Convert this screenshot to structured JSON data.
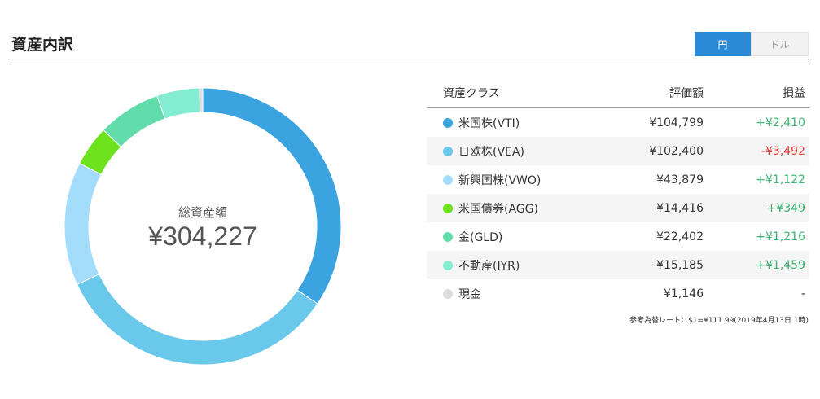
{
  "header": {
    "title": "資産内訳",
    "toggle": [
      "円",
      "ドル"
    ]
  },
  "total": {
    "label": "総資産額",
    "value": "¥304,227"
  },
  "table": {
    "columns": [
      "資産クラス",
      "評価額",
      "損益"
    ],
    "rows": [
      {
        "name": "米国株(VTI)",
        "value": "¥104,799",
        "pnl": "+¥2,410",
        "color": "#3ba3df",
        "sign": "pos",
        "amount": 104799
      },
      {
        "name": "日欧株(VEA)",
        "value": "¥102,400",
        "pnl": "-¥3,492",
        "color": "#6ac8ea",
        "sign": "neg",
        "amount": 102400
      },
      {
        "name": "新興国株(VWO)",
        "value": "¥43,879",
        "pnl": "+¥1,122",
        "color": "#a4ddfb",
        "sign": "pos",
        "amount": 43879
      },
      {
        "name": "米国債券(AGG)",
        "value": "¥14,416",
        "pnl": "+¥349",
        "color": "#6ee21c",
        "sign": "pos",
        "amount": 14416
      },
      {
        "name": "金(GLD)",
        "value": "¥22,402",
        "pnl": "+¥1,216",
        "color": "#63dcab",
        "sign": "pos",
        "amount": 22402
      },
      {
        "name": "不動産(IYR)",
        "value": "¥15,185",
        "pnl": "+¥1,459",
        "color": "#84ecd0",
        "sign": "pos",
        "amount": 15185
      },
      {
        "name": "現金",
        "value": "¥1,146",
        "pnl": "-",
        "color": "#dddddd",
        "sign": "neu",
        "amount": 1146
      }
    ]
  },
  "note": "参考為替レート：$1=¥111.99(2019年4月13日 1時)"
}
